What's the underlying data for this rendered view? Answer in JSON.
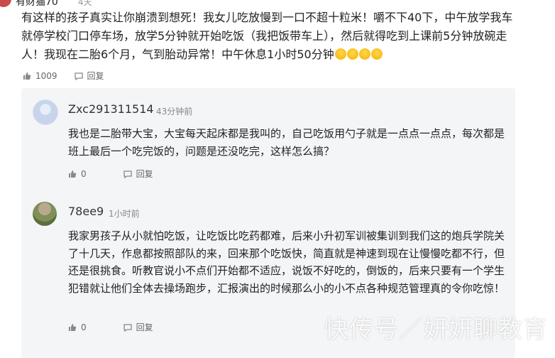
{
  "top_comment": {
    "name_partial": "有财猫70",
    "time_partial": "4天",
    "text": "有这样的孩子真实让你崩溃到想死！我女儿吃放慢到一口不超十粒米！嚼不下40下，中午放学我车就停学校门口停车场，放学5分钟就开始吃饭（我把饭带车上），然后就得吃到上课前5分钟放碗走人！我现在二胎6个月，气到胎动异常！中午休息1小时50分钟",
    "likes": "1009",
    "reply_label": "回复",
    "emoji_icons": [
      "laughing-tears-icon",
      "laughing-tears-icon",
      "laughing-tears-icon",
      "laughing-tears-icon"
    ]
  },
  "replies": [
    {
      "name": "Zxc291311514",
      "time": "43分钟前",
      "text": "我也是二胎带大宝，大宝每天起床都是我叫的，自己吃饭用勺子就是一点点一点点，每次都是班上最后一个吃完饭的，问题是还没吃完，这样怎么搞？",
      "likes": "0",
      "reply_label": "回复"
    },
    {
      "name": "78ee9",
      "time": "1小时前",
      "text": "我家男孩子从小就怕吃饭，让吃饭比吃药都难，后来小升初军训被集训到我们这的炮兵学院关了十几天，作息都按照部队的来，回来那个吃饭快，简直就是神速到现在让慢慢吃都不行，但还是很挑食。听教官说小不点们开始都不适应，说饭不好吃的，倒饭的，后来只要有一个学生犯错就让他们全体去操场跑步，汇报演出的时候那么小的小不点各种规范管理真的令你吃惊！",
      "likes": "0",
      "reply_label": "回复"
    }
  ],
  "watermark": "快传号／妍妍聊教育"
}
